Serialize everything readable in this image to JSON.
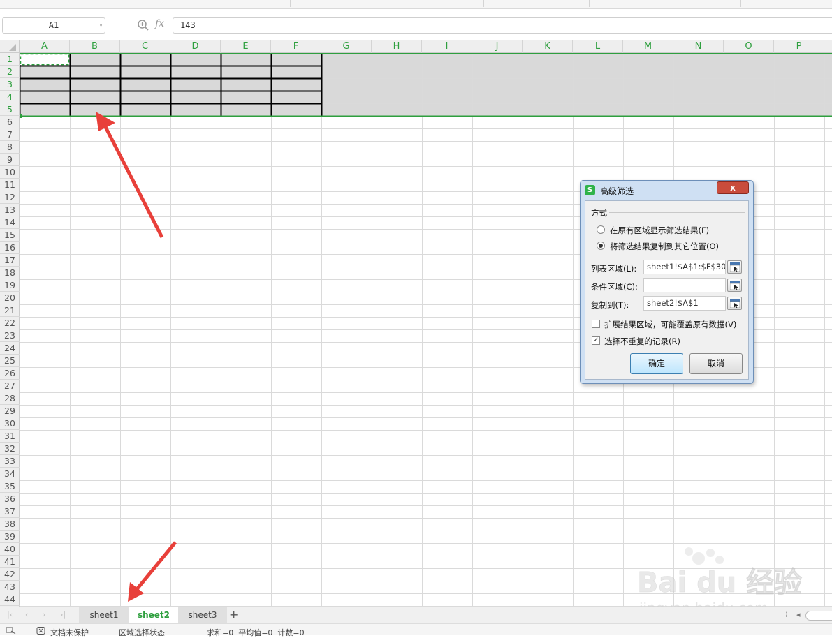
{
  "formula_bar": {
    "name_box": "A1",
    "fx": "fx",
    "formula_value": "143"
  },
  "columns": [
    "A",
    "B",
    "C",
    "D",
    "E",
    "F",
    "G",
    "H",
    "I",
    "J",
    "K",
    "L",
    "M",
    "N",
    "O",
    "P"
  ],
  "rows": [
    "1",
    "2",
    "3",
    "4",
    "5",
    "6",
    "7",
    "8",
    "9",
    "10",
    "11",
    "12",
    "13",
    "14",
    "15",
    "16",
    "17",
    "18",
    "19",
    "20",
    "21",
    "22",
    "23",
    "24",
    "25",
    "26",
    "27",
    "28",
    "29",
    "30",
    "31",
    "32",
    "33",
    "34",
    "35",
    "36",
    "37",
    "38",
    "39",
    "40",
    "41",
    "42",
    "43",
    "44"
  ],
  "sheet_tabs": {
    "tabs": [
      "sheet1",
      "sheet2",
      "sheet3"
    ],
    "active": "sheet2",
    "add": "+"
  },
  "status_bar": {
    "protect": "文档未保护",
    "mode": "区域选择状态",
    "stats": "求和=0  平均值=0  计数=0"
  },
  "dialog": {
    "title": "高级筛选",
    "logo": "S",
    "close": "x",
    "section_label": "方式",
    "option1": "在原有区域显示筛选结果(F)",
    "option2": "将筛选结果复制到其它位置(O)",
    "list_range_label": "列表区域(L):",
    "list_range_value": "sheet1!$A$1:$F$30",
    "criteria_label": "条件区域(C):",
    "criteria_value": "",
    "copy_to_label": "复制到(T):",
    "copy_to_value": "sheet2!$A$1",
    "expand_label": "扩展结果区域，可能覆盖原有数据(V)",
    "unique_label": "选择不重复的记录(R)",
    "ok": "确定",
    "cancel": "取消",
    "option2_selected": true,
    "unique_checked": true,
    "expand_checked": false
  },
  "watermark": {
    "line1": "Bai du 经验",
    "line2": "jingyan.baidu.com"
  },
  "colors": {
    "accent_green": "#2e9f3e",
    "selection_fill": "#d9d9d9",
    "arrow_red": "#e8403a"
  }
}
